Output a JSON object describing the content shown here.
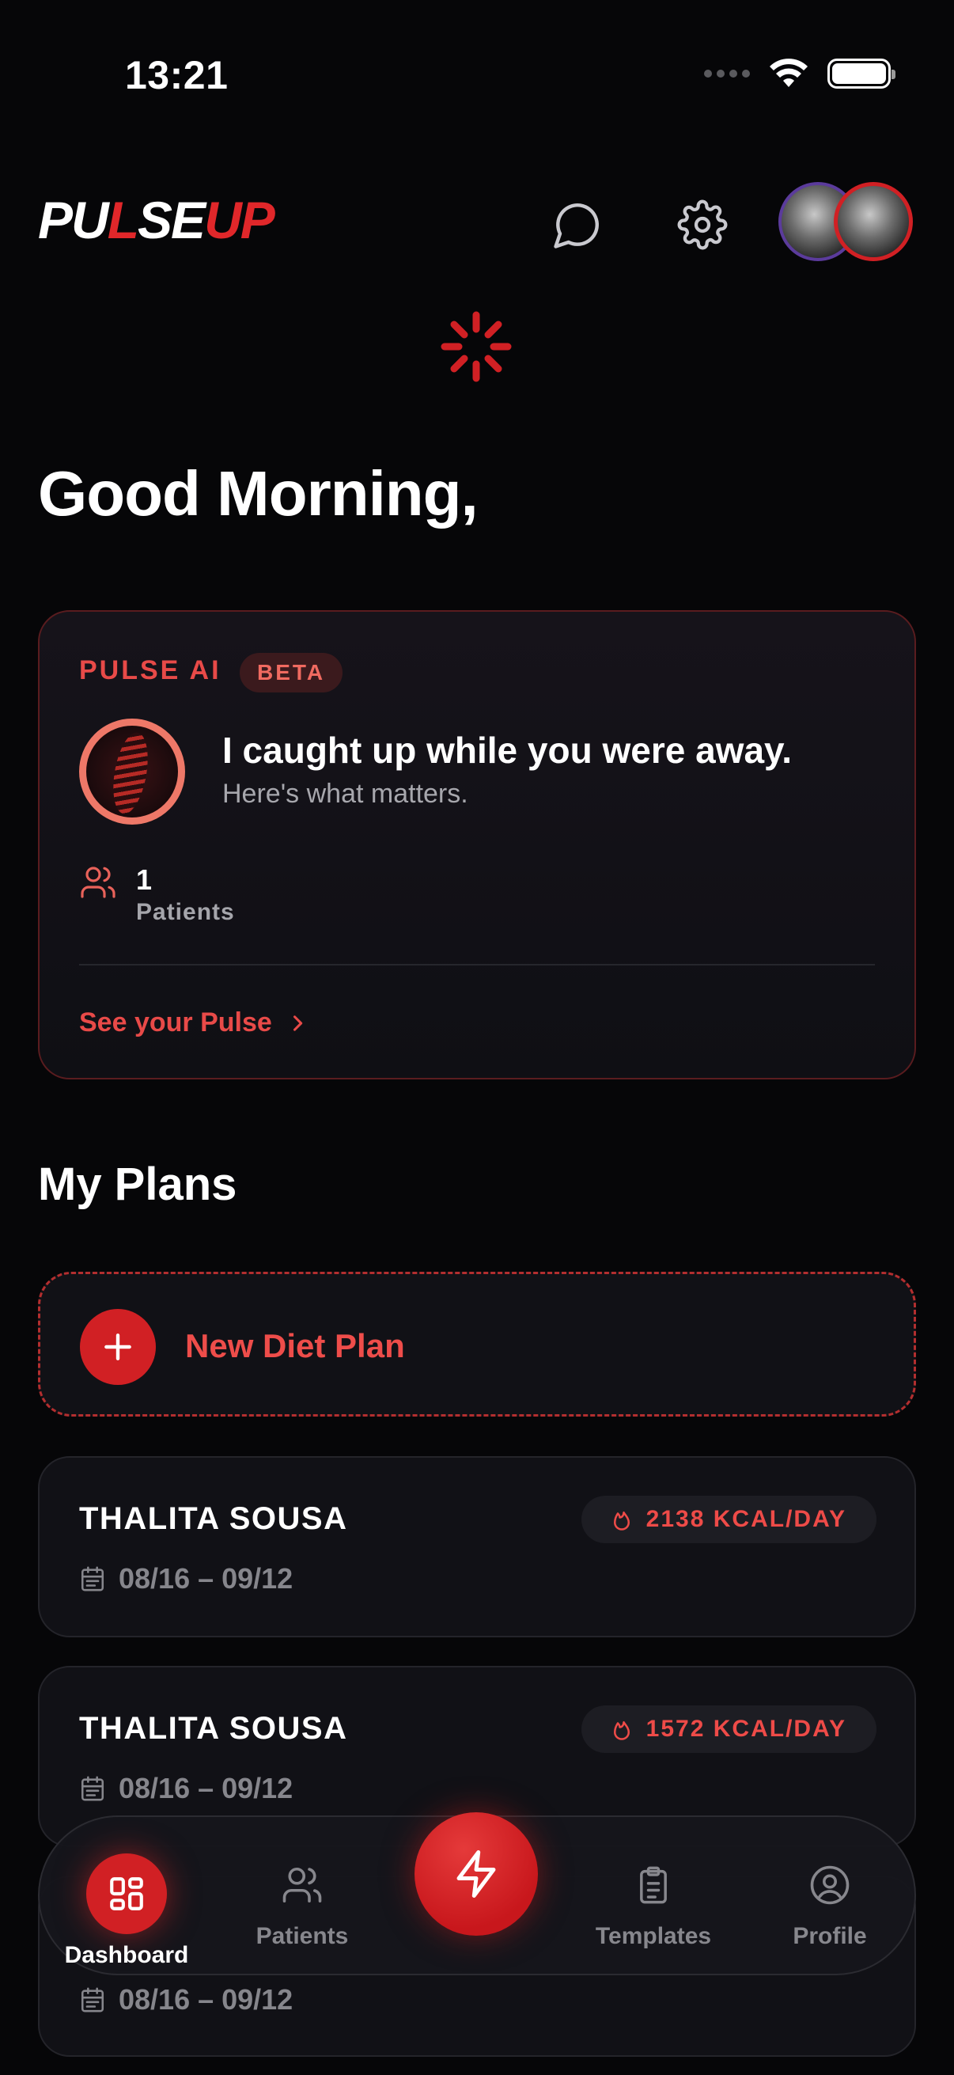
{
  "status_bar": {
    "time": "13:21"
  },
  "header": {
    "logo_white_1": "PU",
    "logo_red_slash": "L",
    "logo_white_2": "SE",
    "logo_red_2": "UP"
  },
  "greeting": "Good Morning,",
  "pulse_ai": {
    "label": "PULSE AI",
    "badge": "BETA",
    "headline": "I caught up while you were away.",
    "subtext": "Here's what matters.",
    "patients_count": "1",
    "patients_label": "Patients",
    "link_label": "See your Pulse"
  },
  "plans": {
    "title": "My Plans",
    "new_plan_label": "New Diet Plan",
    "items": [
      {
        "name": "THALITA SOUSA",
        "kcal": "2138 KCAL/DAY",
        "dates": "08/16 – 09/12"
      },
      {
        "name": "THALITA SOUSA",
        "kcal": "1572 KCAL/DAY",
        "dates": "08/16 – 09/12"
      },
      {
        "name": "",
        "kcal": "",
        "dates": "08/16 – 09/12"
      }
    ]
  },
  "tabbar": {
    "dashboard": "Dashboard",
    "patients": "Patients",
    "templates": "Templates",
    "profile": "Profile"
  },
  "colors": {
    "accent": "#d12024",
    "accent_text": "#e84a48",
    "background": "#060608",
    "card": "#111116"
  },
  "icons": [
    "chat-icon",
    "gear-icon",
    "loading-spinner-icon",
    "users-icon",
    "chevron-right-icon",
    "plus-icon",
    "flame-icon",
    "calendar-icon",
    "dashboard-icon",
    "bolt-icon",
    "clipboard-icon",
    "profile-icon"
  ]
}
